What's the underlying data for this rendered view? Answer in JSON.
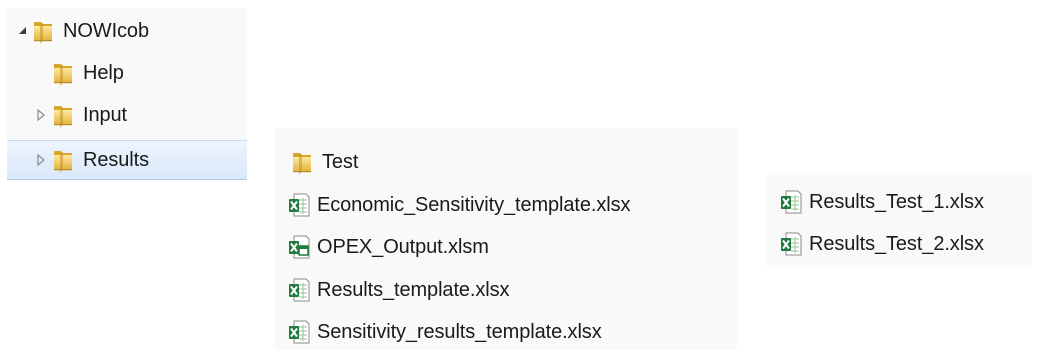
{
  "tree": {
    "items": [
      {
        "label": "NOWIcob",
        "icon": "folder-icon",
        "expander": "expanded"
      },
      {
        "label": "Help",
        "icon": "folder-icon",
        "expander": "none"
      },
      {
        "label": "Input",
        "icon": "folder-icon",
        "expander": "collapsed"
      },
      {
        "label": "Results",
        "icon": "folder-icon",
        "expander": "collapsed",
        "selected": true
      }
    ]
  },
  "results_folder": {
    "items": [
      {
        "label": "Test",
        "icon": "folder-icon"
      },
      {
        "label": "Economic_Sensitivity_template.xlsx",
        "icon": "excel-file-icon"
      },
      {
        "label": "OPEX_Output.xlsm",
        "icon": "excel-macro-file-icon"
      },
      {
        "label": "Results_template.xlsx",
        "icon": "excel-file-icon"
      },
      {
        "label": "Sensitivity_results_template.xlsx",
        "icon": "excel-file-icon"
      }
    ]
  },
  "test_folder": {
    "items": [
      {
        "label": "Results_Test_1.xlsx",
        "icon": "excel-file-icon"
      },
      {
        "label": "Results_Test_2.xlsx",
        "icon": "excel-file-icon"
      }
    ]
  },
  "colors": {
    "folder": "#e8b93c",
    "excel_green": "#1f7a3e",
    "selection": "#d9e8fa"
  }
}
